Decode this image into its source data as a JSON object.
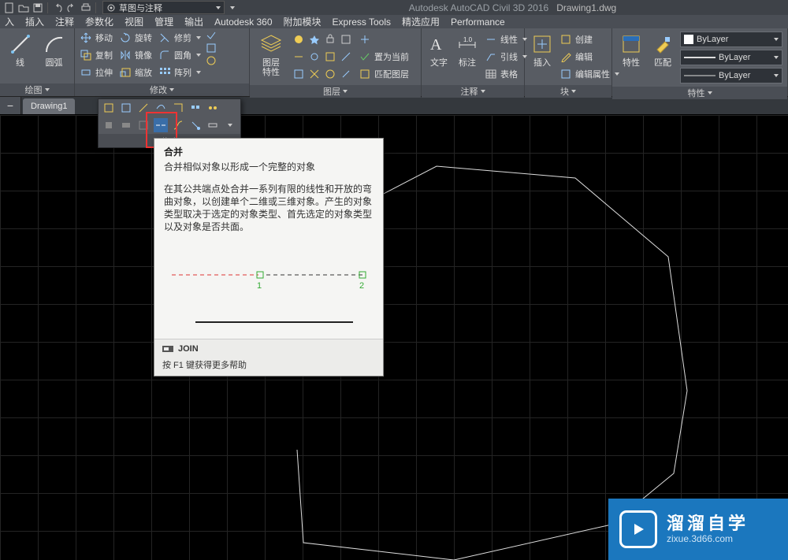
{
  "app_title": "Autodesk AutoCAD Civil 3D 2016",
  "doc_title": "Drawing1.dwg",
  "workspace": "草图与注释",
  "menus": [
    "入",
    "插入",
    "注释",
    "参数化",
    "视图",
    "管理",
    "输出",
    "Autodesk 360",
    "附加模块",
    "Express Tools",
    "精选应用",
    "Performance"
  ],
  "panels": {
    "draw": "绘图",
    "arc": "圆弧",
    "modify": "修改",
    "move": "移动",
    "rotate": "旋转",
    "trim": "修剪",
    "copy": "复制",
    "mirror": "镜像",
    "fillet": "圆角",
    "stretch": "拉伸",
    "scale": "缩放",
    "array": "阵列",
    "layer": "图层",
    "layer_props": "图层\n特性",
    "set_current": "置为当前",
    "match_layer": "匹配图层",
    "anno": "注释",
    "text": "文字",
    "dim": "标注",
    "table": "表格",
    "linear": "线性",
    "leader": "引线",
    "block": "块",
    "insert": "插入",
    "create": "创建",
    "edit": "编辑",
    "edit_attr": "编辑属性",
    "props": "特性",
    "props_btn": "特性",
    "match": "匹配",
    "bylayer": "ByLayer"
  },
  "doctab": "Drawing1",
  "flyout_title": "修改",
  "tooltip": {
    "title": "合并",
    "sub": "合并相似对象以形成一个完整的对象",
    "body": "在其公共端点处合并一系列有限的线性和开放的弯曲对象，以创建单个二维或三维对象。产生的对象类型取决于选定的对象类型、首先选定的对象类型以及对象是否共面。",
    "n1": "1",
    "n2": "2",
    "cmd": "JOIN",
    "help": "按 F1 键获得更多帮助"
  },
  "brand": {
    "t1": "溜溜自学",
    "t2": "zixue.3d66.com"
  }
}
